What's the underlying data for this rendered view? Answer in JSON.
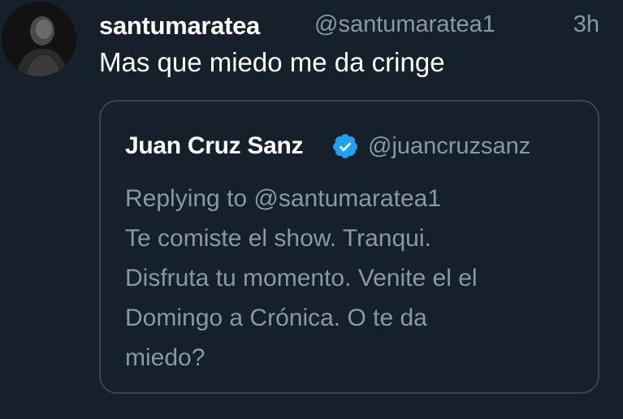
{
  "tweet": {
    "author": {
      "display_name": "santumaratea",
      "handle": "@santumaratea1",
      "avatar_icon": "user-avatar"
    },
    "timestamp": "3h",
    "text": "Mas que miedo me da cringe"
  },
  "quoted_tweet": {
    "author": {
      "display_name": "Juan Cruz Sanz",
      "handle": "@juancruzsanz",
      "verified": true,
      "verified_icon": "verified-badge-icon",
      "verified_color": "#1da1f2"
    },
    "reply_context": "Replying to @santumaratea1",
    "text_lines": [
      "Te comiste el show. Tranqui.",
      "Disfruta tu momento. Venite el el",
      "Domingo a Crónica. O te da",
      "miedo?"
    ]
  },
  "colors": {
    "background": "#15202b",
    "primary_text": "#ffffff",
    "secondary_text": "#8899a6",
    "border": "#38444d"
  }
}
